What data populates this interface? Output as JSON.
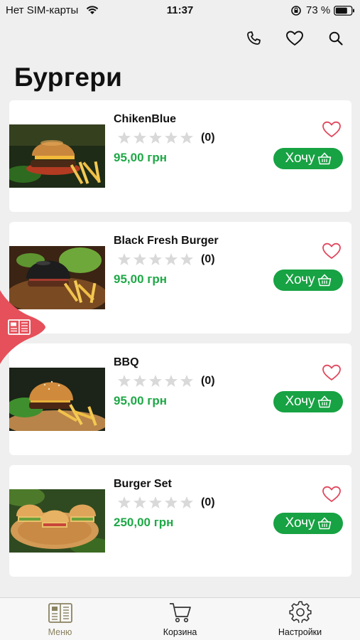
{
  "status_bar": {
    "carrier": "Нет SIM-карты",
    "time": "11:37",
    "battery": "73 %"
  },
  "page": {
    "title": "Бургери"
  },
  "colors": {
    "accent": "#17a243",
    "price": "#1fa847",
    "heart": "#e0475d",
    "star": "#d9d9d9",
    "side_tab": "#e5505a"
  },
  "products": [
    {
      "name": "ChikenBlue",
      "rating": "(0)",
      "price": "95,00 грн",
      "button": "Хочу",
      "stars": 0,
      "favorite": false,
      "image": "burger-with-fries-photo"
    },
    {
      "name": "Black Fresh Burger",
      "rating": "(0)",
      "price": "95,00 грн",
      "button": "Хочу",
      "stars": 0,
      "favorite": false,
      "image": "black-bun-burger-photo"
    },
    {
      "name": "BBQ",
      "rating": "(0)",
      "price": "95,00 грн",
      "button": "Хочу",
      "stars": 0,
      "favorite": false,
      "image": "bbq-burger-photo"
    },
    {
      "name": "Burger Set",
      "rating": "(0)",
      "price": "250,00 грн",
      "button": "Хочу",
      "stars": 0,
      "favorite": false,
      "image": "burger-set-photo"
    }
  ],
  "tab_bar": {
    "tabs": [
      {
        "label": "Меню",
        "icon": "menu-book-icon",
        "active": true
      },
      {
        "label": "Корзина",
        "icon": "cart-icon",
        "active": false
      },
      {
        "label": "Настройки",
        "icon": "gear-icon",
        "active": false
      }
    ]
  }
}
